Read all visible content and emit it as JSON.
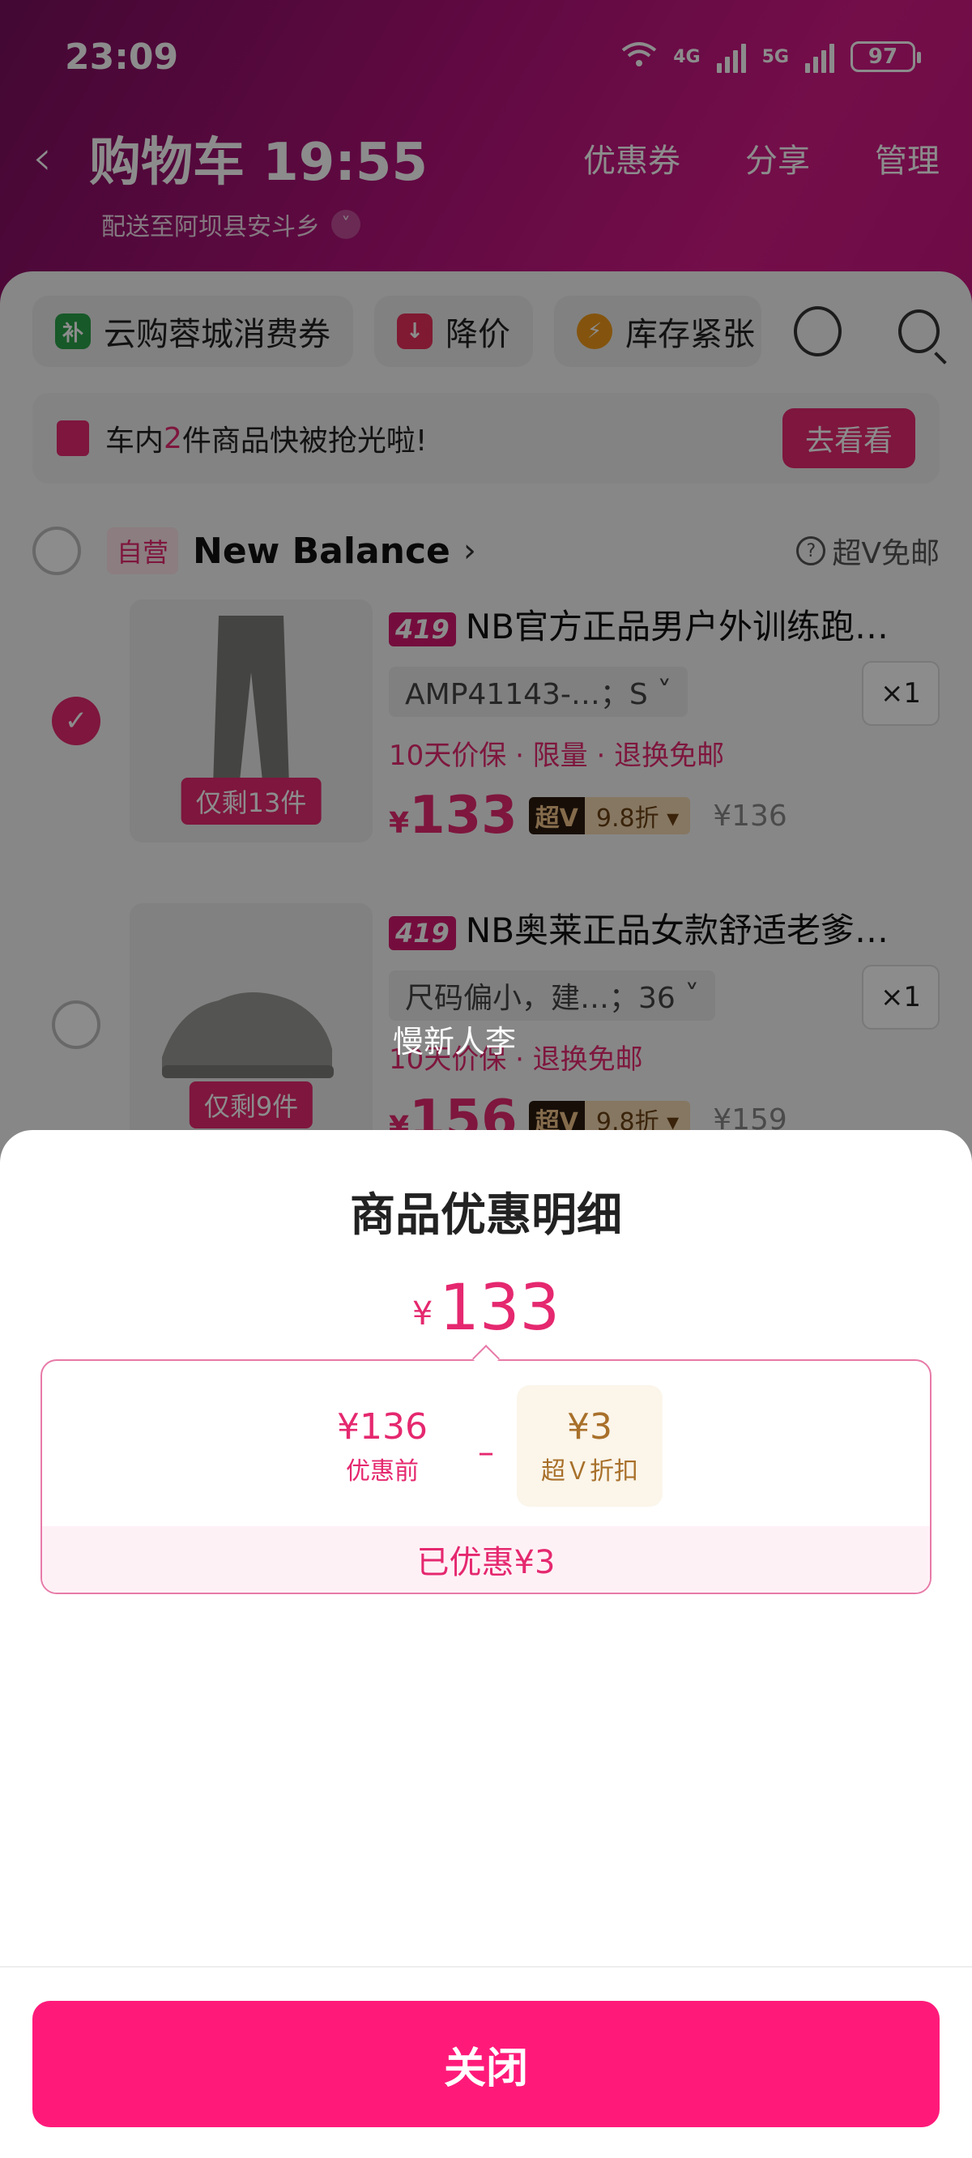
{
  "status_bar": {
    "time": "23:09",
    "net1": "4G",
    "net2": "5G",
    "wifi_num": "6",
    "battery": "97"
  },
  "nav": {
    "back_icon": "chevron-left-icon",
    "title": "购物车 19:55",
    "actions": [
      "优惠券",
      "分享",
      "管理"
    ],
    "address": "配送至阿坝县安斗乡"
  },
  "chips": [
    {
      "label": "云购蓉城消费券",
      "icon": "补",
      "color": "#2aa24a"
    },
    {
      "label": "降价",
      "icon": "↓",
      "color": "#e8305b"
    },
    {
      "label": "库存紧张",
      "icon": "⚡",
      "color": "#f09a1a"
    }
  ],
  "notice": {
    "prefix": "车内",
    "count": "2",
    "suffix": "件商品快被抢光啦!",
    "button": "去看看"
  },
  "store": {
    "badge": "自营",
    "name": "New Balance",
    "freeship": "超V免邮"
  },
  "items": [
    {
      "tag": "419",
      "name": "NB官方正品男户外训练跑…",
      "spec": "AMP41143-…；S",
      "qty": "×1",
      "stock": "仅剩13件",
      "tags": "10天价保 · 限量 · 退换免邮",
      "currency": "¥",
      "price": "133",
      "svip_left": "超V",
      "svip_right": "9.8折 ▾",
      "orig": "¥136"
    },
    {
      "tag": "419",
      "name": "NB奥莱正品女款舒适老爹…",
      "spec": "尺码偏小，建…；36",
      "qty": "×1",
      "stock": "仅剩9件",
      "tags": "10天价保 · 退换免邮",
      "currency": "¥",
      "price": "156",
      "svip_left": "超V",
      "svip_right": "9.8折 ▾",
      "orig": "¥159"
    }
  ],
  "watermark": "慢新人李",
  "sheet": {
    "title": "商品优惠明细",
    "currency": "¥",
    "total": "133",
    "before_value": "¥136",
    "before_label": "优惠前",
    "minus": "–",
    "disc_value": "¥3",
    "disc_label": "超Ｖ折扣",
    "saved": "已优惠¥3",
    "close": "关闭"
  },
  "colors": {
    "accent": "#e5286f",
    "close_button": "#ff1a7a"
  }
}
